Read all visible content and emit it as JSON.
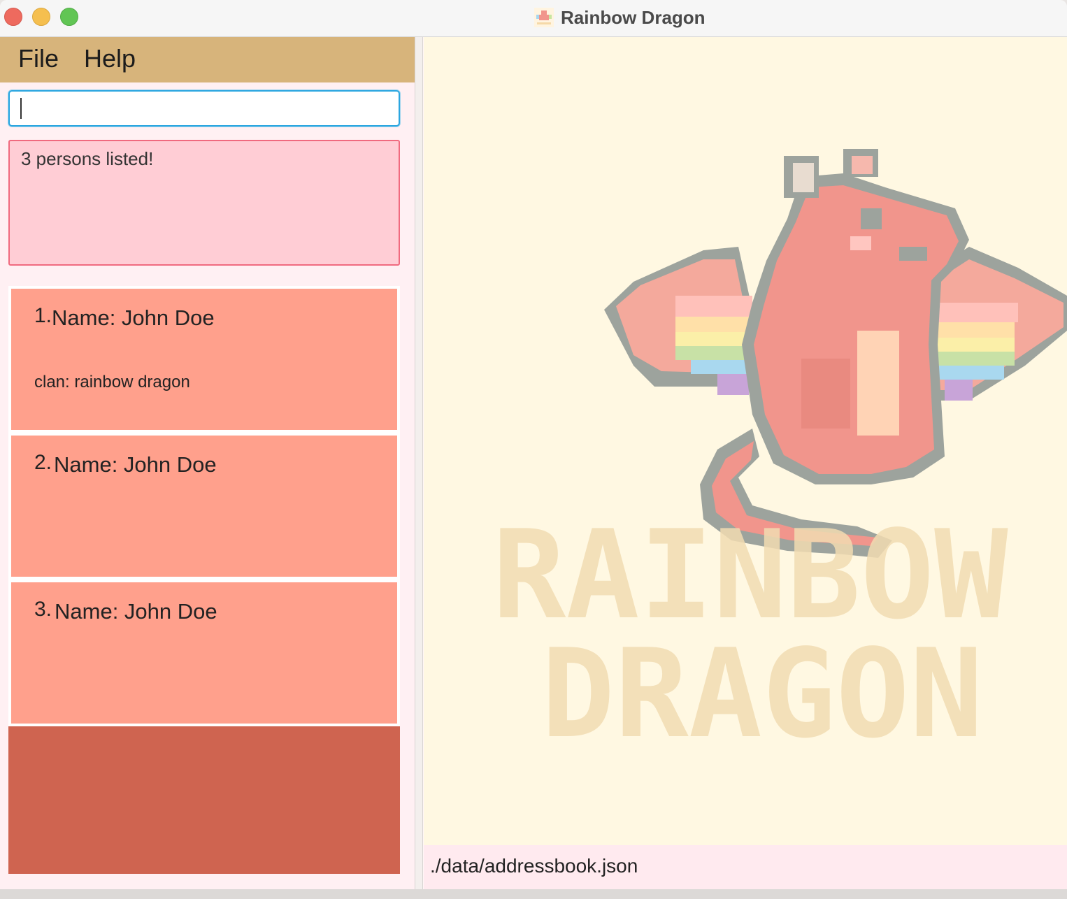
{
  "window": {
    "title": "Rainbow Dragon"
  },
  "menu": {
    "items": [
      "File",
      "Help"
    ]
  },
  "command_box": {
    "value": "",
    "placeholder": ""
  },
  "result_display": {
    "text": "3 persons listed!"
  },
  "persons": [
    {
      "index": "1.",
      "name": "Name: John Doe",
      "clan": "clan: rainbow dragon"
    },
    {
      "index": "2.",
      "name": "Name: John Doe",
      "clan": ""
    },
    {
      "index": "3.",
      "name": "Name: John Doe",
      "clan": ""
    }
  ],
  "logo": {
    "line1": "RAINBOW",
    "line2": "DRAGON"
  },
  "status_bar": {
    "path": "./data/addressbook.json"
  },
  "colors": {
    "menubar": "#d7b47b",
    "result_bg": "#ffcdd5",
    "card_bg": "#ffa08c",
    "list_footer": "#cf6450",
    "right_bg": "#fff8e2",
    "dragon_body": "#f1958c",
    "outline": "#9da39d"
  }
}
